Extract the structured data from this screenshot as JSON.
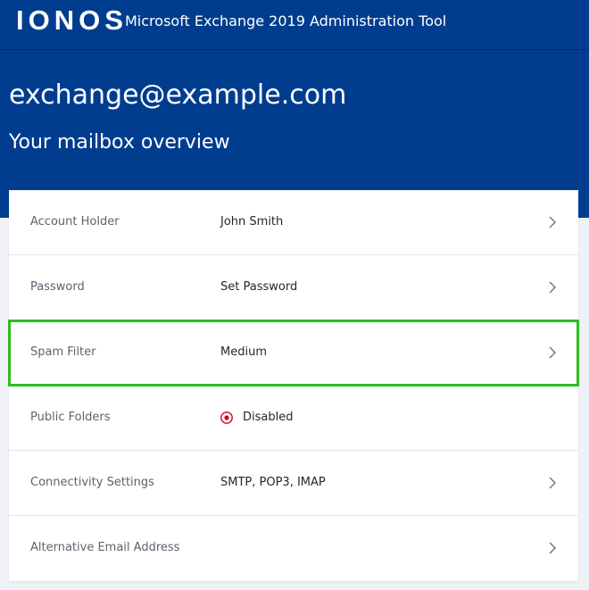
{
  "header": {
    "logo": "IONOS",
    "title": "Microsoft Exchange 2019 Administration Tool"
  },
  "hero": {
    "email": "exchange@example.com",
    "subtitle": "Your mailbox overview"
  },
  "rows": [
    {
      "label": "Account Holder",
      "value": "John Smith"
    },
    {
      "label": "Password",
      "value": "Set Password"
    },
    {
      "label": "Spam Filter",
      "value": "Medium"
    },
    {
      "label": "Public Folders",
      "value": "Disabled",
      "status_icon": "disabled-radio-icon"
    },
    {
      "label": "Connectivity Settings",
      "value": "SMTP, POP3, IMAP"
    },
    {
      "label": "Alternative Email Address",
      "value": ""
    }
  ],
  "colors": {
    "brand": "#003d8f",
    "highlight": "#2ebd1f",
    "disabled": "#d0021b"
  }
}
